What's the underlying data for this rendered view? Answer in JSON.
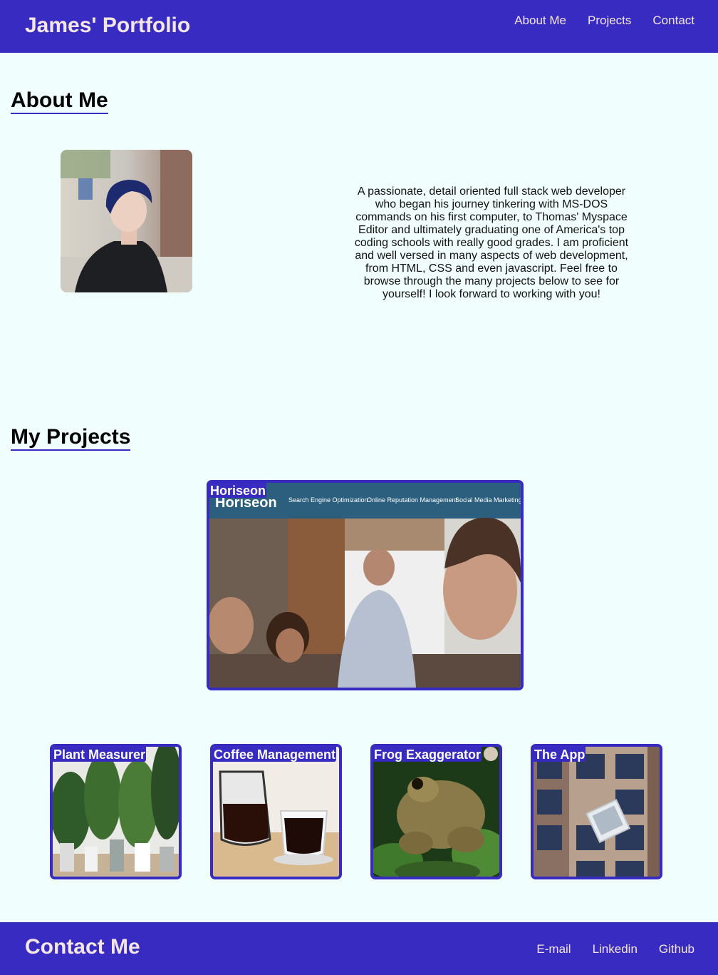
{
  "header": {
    "brand": "James' Portfolio",
    "nav": [
      "About Me",
      "Projects",
      "Contact"
    ]
  },
  "about": {
    "title": "About Me",
    "photo_icon": "portrait-photo",
    "bio": "A passionate, detail oriented full stack web developer who began his journey tinkering with MS-DOS commands on his first computer, to Thomas' Myspace Editor and ultimately graduating one of America's top coding schools with really good grades. I am proficient and well versed in many aspects of web development, from HTML, CSS and even javascript. Feel free to browse through the many projects below to see for yourself! I look forward to working with you!"
  },
  "projects": {
    "title": "My Projects",
    "featured": {
      "title": "Horiseon",
      "screenshot_logo": "Horiseon",
      "screenshot_nav": [
        "Search Engine Optimization",
        "Online Reputation Management",
        "Social Media Marketing"
      ]
    },
    "cards": [
      {
        "title": "Plant Measurer",
        "image": "plants-photo"
      },
      {
        "title": "Coffee Management",
        "image": "coffee-photo"
      },
      {
        "title": "Frog Exaggerator",
        "image": "frog-photo"
      },
      {
        "title": "The App",
        "image": "building-photo"
      }
    ]
  },
  "footer": {
    "title": "Contact Me",
    "links": [
      "E-mail",
      "Linkedin",
      "Github"
    ]
  },
  "colors": {
    "primary": "#382bc2",
    "background": "#f0fffe",
    "header_text": "#f5e6e6"
  }
}
